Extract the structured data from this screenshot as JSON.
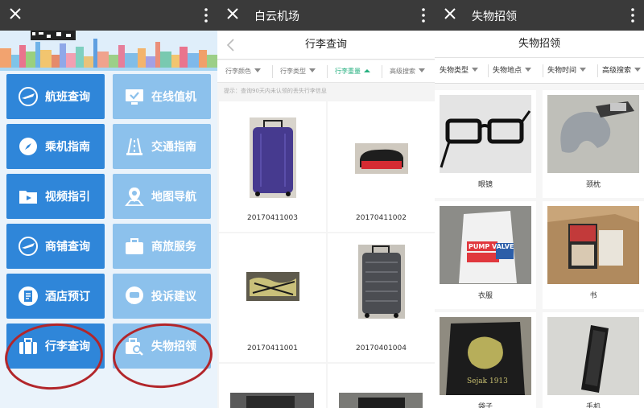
{
  "screen1": {
    "tiles": [
      {
        "label": "航班查询",
        "icon": "plane-icon"
      },
      {
        "label": "在线值机",
        "icon": "monitor-check-icon"
      },
      {
        "label": "乘机指南",
        "icon": "compass-icon"
      },
      {
        "label": "交通指南",
        "icon": "road-icon"
      },
      {
        "label": "视频指引",
        "icon": "video-folder-icon"
      },
      {
        "label": "地图导航",
        "icon": "map-pin-icon"
      },
      {
        "label": "商铺查询",
        "icon": "plane-icon"
      },
      {
        "label": "商旅服务",
        "icon": "briefcase-icon"
      },
      {
        "label": "酒店预订",
        "icon": "hotel-doc-icon"
      },
      {
        "label": "投诉建议",
        "icon": "chat-bubble-icon"
      },
      {
        "label": "行李查询",
        "icon": "luggage-icon"
      },
      {
        "label": "失物招领",
        "icon": "search-bag-icon"
      }
    ]
  },
  "screen2": {
    "app_title": "白云机场",
    "header_title": "行李查询",
    "filters": [
      "行李颜色",
      "行李类型",
      "行李重量",
      "高级搜索"
    ],
    "hint": "提示：查询90天内未认领的丢失行李信息",
    "items": [
      "20170411003",
      "20170411002",
      "20170411001",
      "20170401004"
    ]
  },
  "screen3": {
    "app_title": "失物招领",
    "header_title": "失物招领",
    "filters": [
      "失物类型",
      "失物地点",
      "失物时间",
      "高级搜索"
    ],
    "items": [
      "眼镜",
      "颈枕",
      "衣服",
      "书",
      "袋子",
      "手机"
    ],
    "tag_text": "PUMP VALVE",
    "bag_text": "Sejak 1913"
  },
  "colors": {
    "tile_dark": "#2f86d9",
    "tile_light": "#8cc1ec",
    "accent_green": "#27b080",
    "circle_red": "#b2262b",
    "titlebar": "#3a3a3a"
  }
}
